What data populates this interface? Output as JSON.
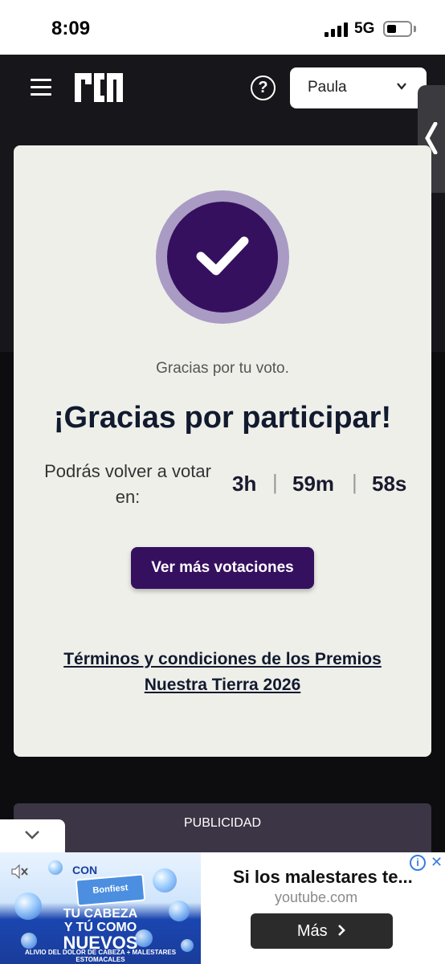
{
  "status_bar": {
    "time": "8:09",
    "network": "5G"
  },
  "header": {
    "logo_icon": "rcn-logo",
    "help_icon": "?",
    "profile": {
      "selected": "Paula"
    }
  },
  "card": {
    "subtitle": "Gracias por tu voto.",
    "headline": "¡Gracias por participar!",
    "vote_again_label": "Podrás volver a votar en:",
    "timer": {
      "hours": "3h",
      "minutes": "59m",
      "seconds": "58s",
      "separator": "|"
    },
    "more_button": "Ver más votaciones",
    "terms_line1": "Términos y condiciones de los Premios",
    "terms_line2": "Nuestra Tierra 2026"
  },
  "ad": {
    "label": "PUBLICIDAD",
    "image": {
      "con": "CON",
      "product": "Bonfiest",
      "slogan_line1": "TU CABEZA",
      "slogan_line2": "Y TÚ COMO",
      "slogan_line3": "NUEVOS",
      "alivio": "ALIVIO DEL DOLOR DE CABEZA + MALESTARES ESTOMACALES"
    },
    "title": "Si los malestares te...",
    "domain": "youtube.com",
    "cta": "Más",
    "info": "i",
    "close": "✕"
  },
  "colors": {
    "accent": "#35105f",
    "accent_light": "#a99bc3",
    "header_bg": "#17171b",
    "card_bg": "#efefea"
  }
}
